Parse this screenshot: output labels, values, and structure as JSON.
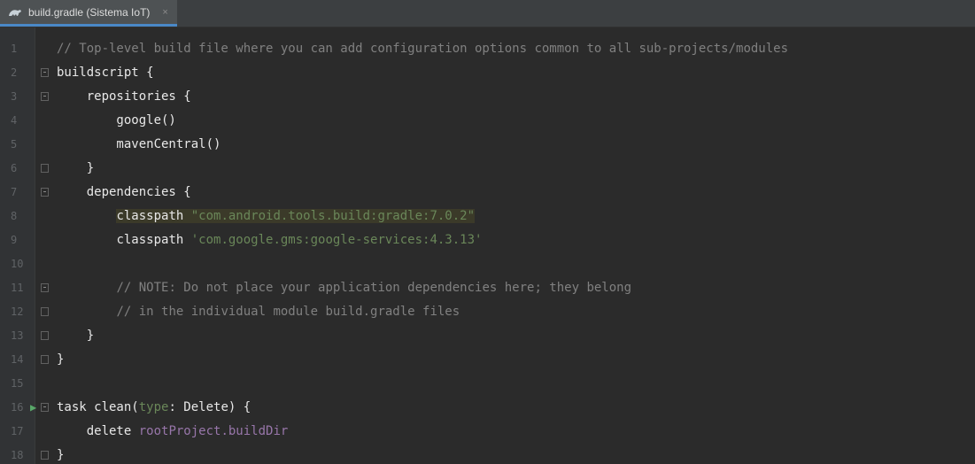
{
  "tab": {
    "title": "build.gradle (Sistema IoT)",
    "close": "×"
  },
  "gutter": {
    "run_icon": "run-triangle-icon",
    "lines": [
      "1",
      "2",
      "3",
      "4",
      "5",
      "6",
      "7",
      "8",
      "9",
      "10",
      "11",
      "12",
      "13",
      "14",
      "15",
      "16",
      "17",
      "18"
    ]
  },
  "code": {
    "l1_comment": "// Top-level build file where you can add configuration options common to all sub-projects/modules",
    "l2_kw": "buildscript",
    "l2_brace": " {",
    "l3_indent": "    ",
    "l3_kw": "repositories",
    "l3_brace": " {",
    "l4": "        google()",
    "l5": "        mavenCentral()",
    "l6": "    }",
    "l7_indent": "    ",
    "l7_kw": "dependencies",
    "l7_brace": " {",
    "l8_indent": "        ",
    "l8_kw": "classpath",
    "l8_space": " ",
    "l8_str": "\"com.android.tools.build:gradle:7.0.2\"",
    "l9_indent": "        ",
    "l9_kw": "classpath",
    "l9_space": " ",
    "l9_str": "'com.google.gms:google-services:4.3.13'",
    "l10": "",
    "l11_indent": "        ",
    "l11_comment": "// NOTE: Do not place your application dependencies here; they belong",
    "l12_indent": "        ",
    "l12_comment": "// in the individual module build.gradle files",
    "l13": "    }",
    "l14": "}",
    "l15": "",
    "l16_kw": "task",
    "l16_a": " clean(",
    "l16_type": "type",
    "l16_b": ": Delete) {",
    "l17_indent": "    ",
    "l17_kw": "delete",
    "l17_space": " ",
    "l17_prop": "rootProject.buildDir",
    "l18": "}"
  },
  "colors": {
    "background": "#2b2b2b",
    "comment": "#808080",
    "string": "#6a8759",
    "property": "#9876aa",
    "keyword": "#cc7832",
    "default_text": "#a9b7c6"
  }
}
